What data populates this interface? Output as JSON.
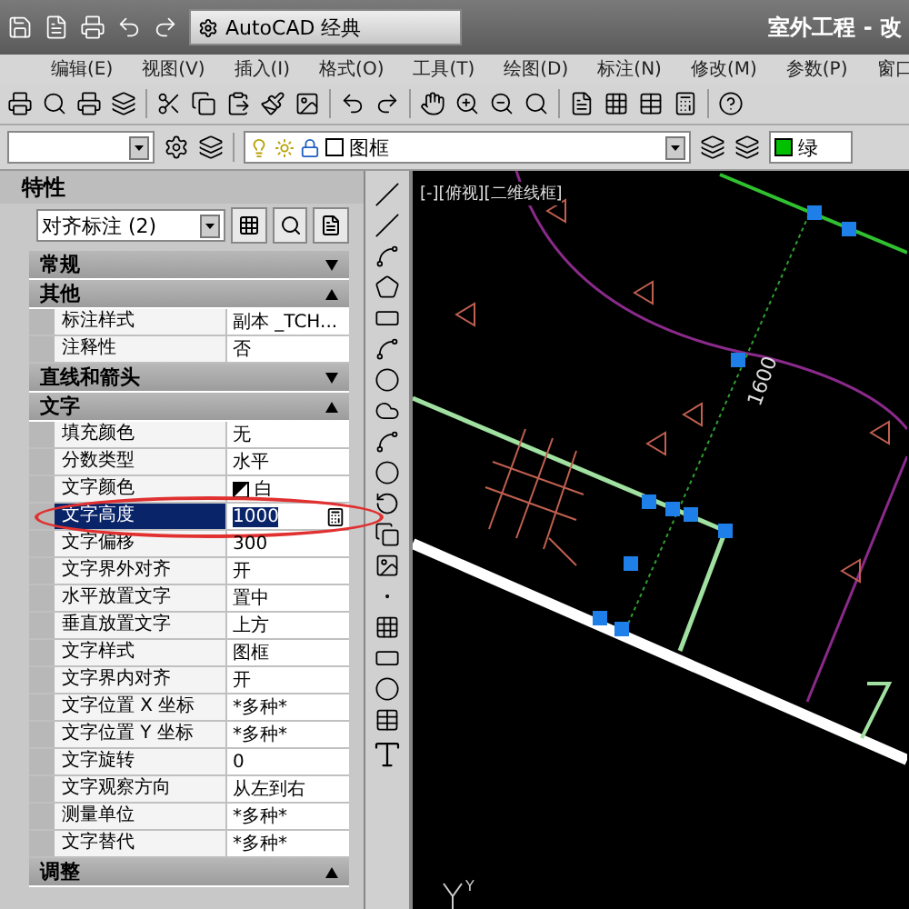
{
  "title_bar": {
    "workspace": "AutoCAD 经典",
    "title": "室外工程 - 改"
  },
  "menu": [
    "编辑(E)",
    "视图(V)",
    "插入(I)",
    "格式(O)",
    "工具(T)",
    "绘图(D)",
    "标注(N)",
    "修改(M)",
    "参数(P)",
    "窗口"
  ],
  "layer_toolbar": {
    "layer": "图框",
    "color_name": "绿",
    "color": "#00c000"
  },
  "properties": {
    "title": "特性",
    "selection": "对齐标注 (2)",
    "sections": [
      {
        "title": "常规",
        "expanded": false
      },
      {
        "title": "其他",
        "expanded": true,
        "rows": [
          {
            "name": "标注样式",
            "value": "副本 _TCH...",
            "selected": false
          },
          {
            "name": "注释性",
            "value": "否",
            "selected": false
          }
        ]
      },
      {
        "title": "直线和箭头",
        "expanded": false
      },
      {
        "title": "文字",
        "expanded": true,
        "rows": [
          {
            "name": "填充颜色",
            "value": "无",
            "selected": false
          },
          {
            "name": "分数类型",
            "value": "水平",
            "selected": false
          },
          {
            "name": "文字颜色",
            "value": "白",
            "selected": false,
            "kind": "color"
          },
          {
            "name": "文字高度",
            "value": "1000",
            "selected": true
          },
          {
            "name": "文字偏移",
            "value": "300",
            "selected": false
          },
          {
            "name": "文字界外对齐",
            "value": "开",
            "selected": false
          },
          {
            "name": "水平放置文字",
            "value": "置中",
            "selected": false
          },
          {
            "name": "垂直放置文字",
            "value": "上方",
            "selected": false
          },
          {
            "name": "文字样式",
            "value": "图框",
            "selected": false
          },
          {
            "name": "文字界内对齐",
            "value": "开",
            "selected": false
          },
          {
            "name": "文字位置 X 坐标",
            "value": "*多种*",
            "selected": false
          },
          {
            "name": "文字位置 Y 坐标",
            "value": "*多种*",
            "selected": false
          },
          {
            "name": "文字旋转",
            "value": "0",
            "selected": false
          },
          {
            "name": "文字观察方向",
            "value": "从左到右",
            "selected": false
          },
          {
            "name": "测量单位",
            "value": "*多种*",
            "selected": false
          },
          {
            "name": "文字替代",
            "value": "*多种*",
            "selected": false
          }
        ]
      },
      {
        "title": "调整",
        "expanded": true
      }
    ]
  },
  "viewport": {
    "label": "[-][俯视][二维线框]",
    "dimension": "1600",
    "ucs_label": "Y"
  }
}
